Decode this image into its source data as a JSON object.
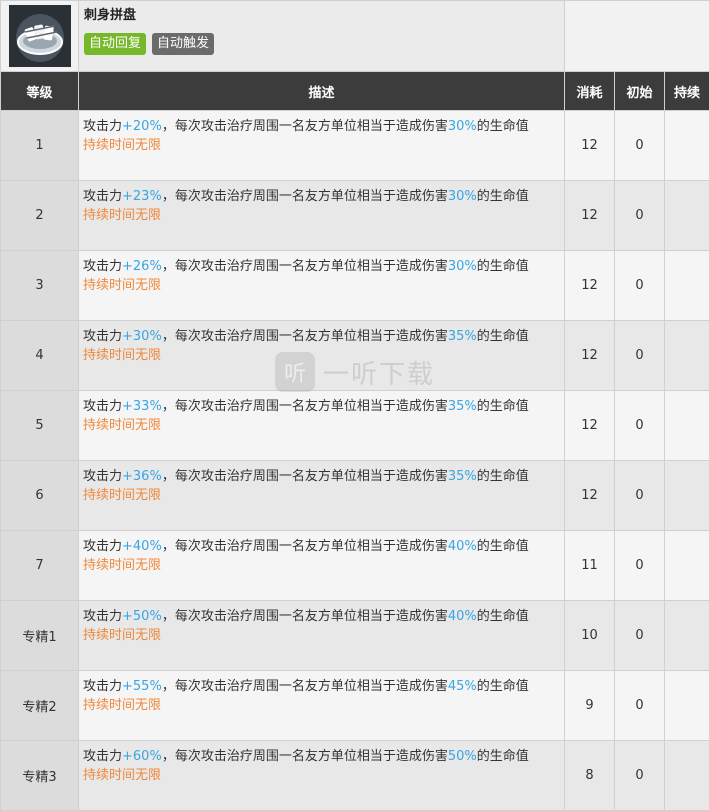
{
  "skill": {
    "name": "刺身拼盘",
    "icon": "sashimi-platter-icon",
    "tags": [
      {
        "label": "自动回复",
        "color": "#76b82a"
      },
      {
        "label": "自动触发",
        "color": "#6b6b6b"
      }
    ]
  },
  "headers": {
    "level": "等级",
    "description": "描述",
    "cost": "消耗",
    "initial": "初始",
    "duration": "持续"
  },
  "desc_parts": {
    "atk_prefix": "攻击力",
    "heal_text": "，每次攻击治疗周围一名友方单位相当于造成伤害",
    "hp_suffix": "的生命值",
    "duration_text": "持续时间无限"
  },
  "levels": [
    {
      "level": "1",
      "atk": "+20%",
      "heal": "30%",
      "cost": "12",
      "initial": "0",
      "duration": ""
    },
    {
      "level": "2",
      "atk": "+23%",
      "heal": "30%",
      "cost": "12",
      "initial": "0",
      "duration": ""
    },
    {
      "level": "3",
      "atk": "+26%",
      "heal": "30%",
      "cost": "12",
      "initial": "0",
      "duration": ""
    },
    {
      "level": "4",
      "atk": "+30%",
      "heal": "35%",
      "cost": "12",
      "initial": "0",
      "duration": ""
    },
    {
      "level": "5",
      "atk": "+33%",
      "heal": "35%",
      "cost": "12",
      "initial": "0",
      "duration": ""
    },
    {
      "level": "6",
      "atk": "+36%",
      "heal": "35%",
      "cost": "12",
      "initial": "0",
      "duration": ""
    },
    {
      "level": "7",
      "atk": "+40%",
      "heal": "40%",
      "cost": "11",
      "initial": "0",
      "duration": ""
    },
    {
      "level": "专精1",
      "atk": "+50%",
      "heal": "40%",
      "cost": "10",
      "initial": "0",
      "duration": ""
    },
    {
      "level": "专精2",
      "atk": "+55%",
      "heal": "45%",
      "cost": "9",
      "initial": "0",
      "duration": ""
    },
    {
      "level": "专精3",
      "atk": "+60%",
      "heal": "50%",
      "cost": "8",
      "initial": "0",
      "duration": ""
    }
  ],
  "watermark": {
    "logo_glyph": "听",
    "text": "一听下载"
  },
  "colors": {
    "highlight": "#39a5e4",
    "duration": "#f0883a",
    "header_bg": "#3c3c3c"
  }
}
